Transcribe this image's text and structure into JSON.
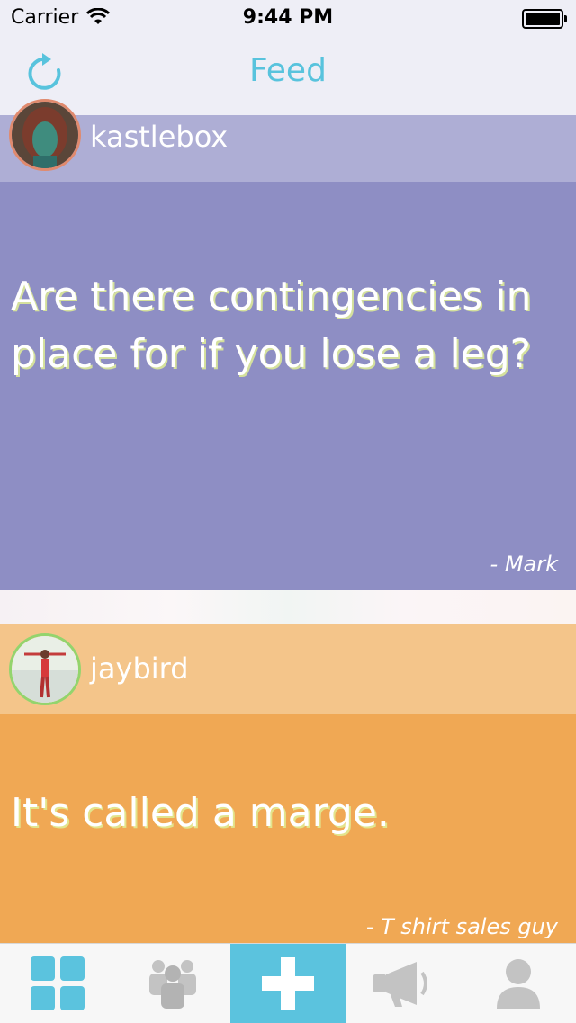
{
  "status_bar": {
    "carrier": "Carrier",
    "time": "9:44 PM"
  },
  "nav": {
    "title": "Feed",
    "refresh_icon": "refresh-icon"
  },
  "posts": [
    {
      "username": "kastlebox",
      "text": "Are there contingencies in place for if you lose a leg?",
      "author": "- Mark",
      "color": "#8e8ec4",
      "header_color": "#aeaed5",
      "avatar_ring": "#e08a6e"
    },
    {
      "username": "jaybird",
      "text": "It's called a marge.",
      "author": "- T shirt sales guy",
      "color": "#f0a854",
      "header_color": "#f4c58a",
      "avatar_ring": "#93d46d"
    }
  ],
  "tabs": [
    {
      "icon": "grid-icon",
      "active": false
    },
    {
      "icon": "people-icon",
      "active": false
    },
    {
      "icon": "plus-icon",
      "active": true
    },
    {
      "icon": "megaphone-icon",
      "active": false
    },
    {
      "icon": "profile-icon",
      "active": false
    }
  ],
  "colors": {
    "accent": "#5bc3de",
    "nav_title": "#58c3dd",
    "inactive_icon": "#c3c3c3"
  }
}
